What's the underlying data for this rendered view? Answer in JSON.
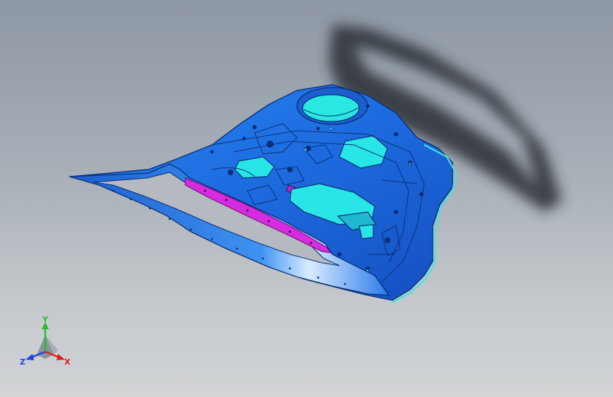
{
  "viewport": {
    "background_top": "#8e98a4",
    "background_bottom": "#d2d4d6"
  },
  "model": {
    "part_color": "#1e6fe0",
    "edge_color": "#0b2f78",
    "cyan_face_color": "#28e6e6",
    "magenta_strip_color": "#d62be0",
    "shadow_color": "#2b2f35"
  },
  "triad": {
    "x_label": "X",
    "y_label": "Y",
    "z_label": "Z",
    "x_color": "#e02020",
    "y_color": "#22c022",
    "z_color": "#2040e0"
  }
}
